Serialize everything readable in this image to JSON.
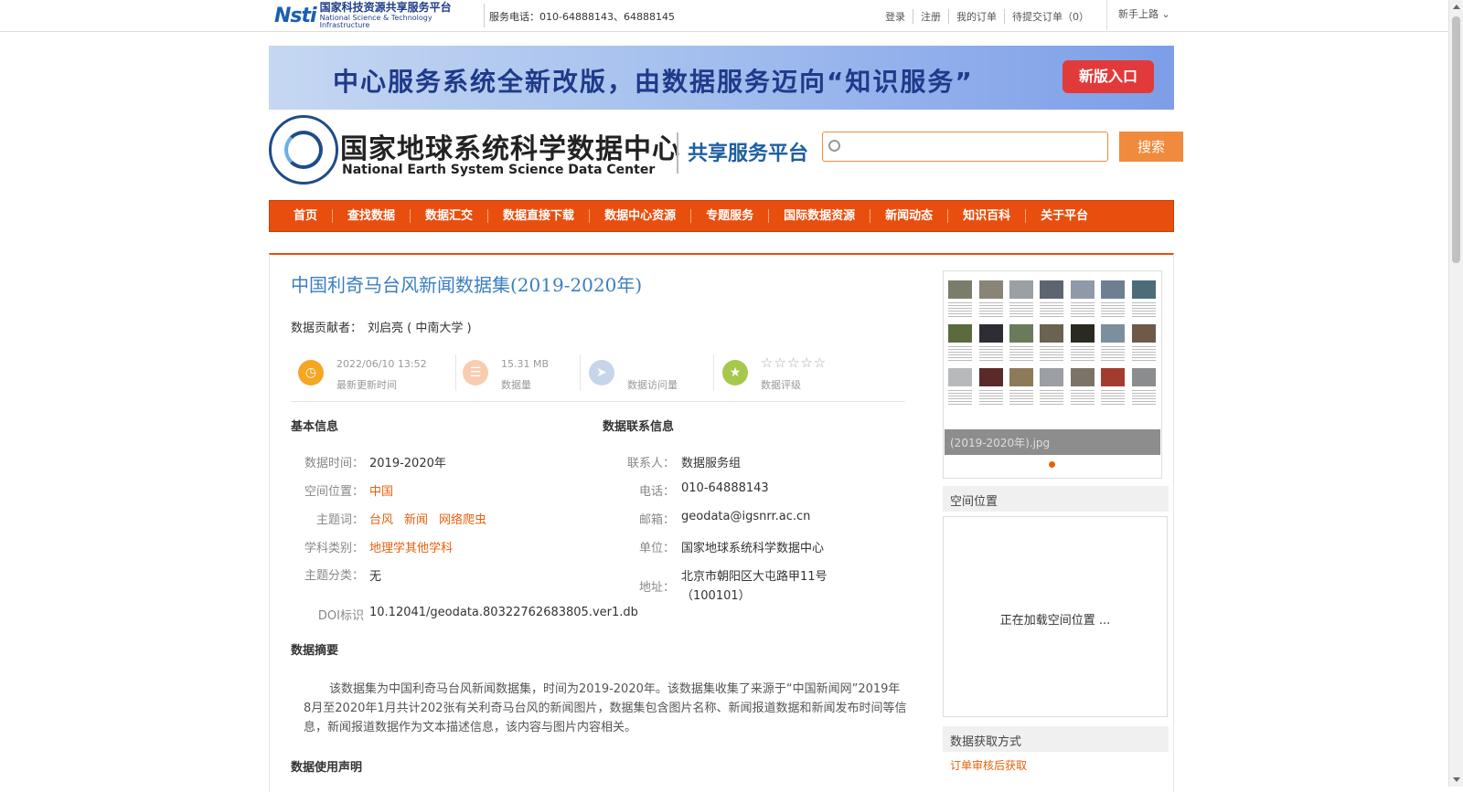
{
  "topbar": {
    "platform_cn": "国家科技资源共享服务平台",
    "platform_en": "National Science & Technology Infrastructure",
    "logo_mark": "Nsti",
    "service_phone": "服务电话：010-64888143、64888145",
    "links": [
      "登录",
      "注册",
      "我的订单",
      "待提交订单（0）"
    ],
    "guide": "新手上路"
  },
  "banner": {
    "text": "中心服务系统全新改版，由数据服务迈向“知识服务”",
    "button": "新版入口"
  },
  "header": {
    "center_cn": "国家地球系统科学数据中心",
    "center_en": "National Earth System Science Data Center",
    "platform": "共享服务平台",
    "search_placeholder": "",
    "search_button": "搜索"
  },
  "nav": [
    "首页",
    "查找数据",
    "数据汇交",
    "数据直接下载",
    "数据中心资源",
    "专题服务",
    "国际数据资源",
    "新闻动态",
    "知识百科",
    "关于平台"
  ],
  "dataset": {
    "title": "中国利奇马台风新闻数据集(2019-2020年)",
    "contributor_label": "数据贡献者：",
    "contributor": "刘启亮 ( 中南大学 )",
    "stats": {
      "updated_value": "2022/06/10 13:52",
      "updated_label": "最新更新时间",
      "size_value": "15.31 MB",
      "size_label": "数据量",
      "visits_value": "",
      "visits_label": "数据访问量",
      "rating_stars": "☆☆☆☆☆",
      "rating_label": "数据评级"
    },
    "basic_info": {
      "heading": "基本信息",
      "time_label": "数据时间：",
      "time": "2019-2020年",
      "location_label": "空间位置：",
      "location": "中国",
      "keywords_label": "主题词：",
      "keywords": [
        "台风",
        "新闻",
        "网络爬虫"
      ],
      "discipline_label": "学科类别：",
      "discipline": "地理学其他学科",
      "category_label": "主题分类：",
      "category": "无",
      "doi_label": "DOI标识",
      "doi": "10.12041/geodata.80322762683805.ver1.db"
    },
    "contact_info": {
      "heading": "数据联系信息",
      "contact_label": "联系人：",
      "contact": "数据服务组",
      "phone_label": "电话：",
      "phone": "010-64888143",
      "email_label": "邮箱：",
      "email": "geodata@igsnrr.ac.cn",
      "unit_label": "单位：",
      "unit": "国家地球系统科学数据中心",
      "address_label": "地址：",
      "address_line1": "北京市朝阳区大屯路甲11号",
      "address_line2": "（100101）"
    },
    "abstract_heading": "数据摘要",
    "abstract": "该数据集为中国利奇马台风新闻数据集，时间为2019-2020年。该数据集收集了来源于“中国新闻网”2019年8月至2020年1月共计202张有关利奇马台风的新闻图片，数据集包含图片名称、新闻报道数据和新闻发布时间等信息，新闻报道数据作为文本描述信息，该内容与图片内容相关。",
    "usage_heading": "数据使用声明"
  },
  "sidebar": {
    "thumb_caption": "(2019-2020年).jpg",
    "spatial_heading": "空间位置",
    "map_loading": "正在加载空间位置 ...",
    "access_heading": "数据获取方式",
    "access_link": "订单审核后获取"
  },
  "colors": {
    "accent": "#e84f0e",
    "title_blue": "#3a7fc0",
    "banner_button": "#e23a3a"
  }
}
